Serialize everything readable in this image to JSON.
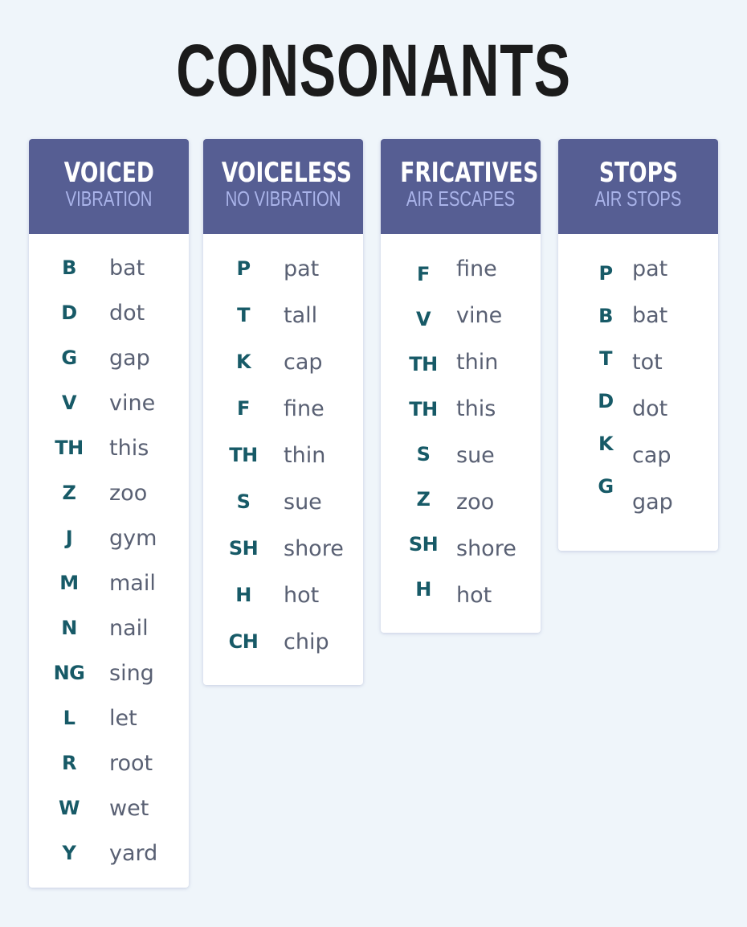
{
  "title": "CONSONANTS",
  "colors": {
    "background": "#eff5fa",
    "header": "#565e93",
    "header_title": "#ffffff",
    "header_subtitle": "#aab4ea",
    "symbol": "#175a67",
    "word": "#596073"
  },
  "cards": [
    {
      "title": "VOICED",
      "subtitle": "VIBRATION",
      "rows": [
        {
          "symbol": "B",
          "word": "bat"
        },
        {
          "symbol": "D",
          "word": "dot"
        },
        {
          "symbol": "G",
          "word": "gap"
        },
        {
          "symbol": "V",
          "word": "vine"
        },
        {
          "symbol": "TH",
          "word": "this"
        },
        {
          "symbol": "Z",
          "word": "zoo"
        },
        {
          "symbol": "J",
          "word": "gym"
        },
        {
          "symbol": "M",
          "word": "mail"
        },
        {
          "symbol": "N",
          "word": "nail"
        },
        {
          "symbol": "NG",
          "word": "sing"
        },
        {
          "symbol": "L",
          "word": "let"
        },
        {
          "symbol": "R",
          "word": "root"
        },
        {
          "symbol": "W",
          "word": "wet"
        },
        {
          "symbol": "Y",
          "word": "yard"
        }
      ]
    },
    {
      "title": "VOICELESS",
      "subtitle": "NO VIBRATION",
      "rows": [
        {
          "symbol": "P",
          "word": "pat"
        },
        {
          "symbol": "T",
          "word": "tall"
        },
        {
          "symbol": "K",
          "word": "cap"
        },
        {
          "symbol": "F",
          "word": "fine"
        },
        {
          "symbol": "TH",
          "word": "thin"
        },
        {
          "symbol": "S",
          "word": "sue"
        },
        {
          "symbol": "SH",
          "word": "shore"
        },
        {
          "symbol": "H",
          "word": "hot"
        },
        {
          "symbol": "CH",
          "word": "chip"
        }
      ]
    },
    {
      "title": "FRICATIVES",
      "subtitle": "AIR ESCAPES",
      "symbols": [
        "F",
        "V",
        "TH",
        "TH",
        "S",
        "Z",
        "SH",
        "H"
      ],
      "words": [
        "fine",
        "vine",
        "thin",
        "this",
        "sue",
        "zoo",
        "shore",
        "hot"
      ]
    },
    {
      "title": "STOPS",
      "subtitle": "AIR STOPS",
      "symbols": [
        "P",
        "B",
        "T",
        "D",
        "K",
        "G"
      ],
      "words": [
        "pat",
        "bat",
        "tot",
        "dot",
        "cap",
        "gap"
      ]
    }
  ]
}
